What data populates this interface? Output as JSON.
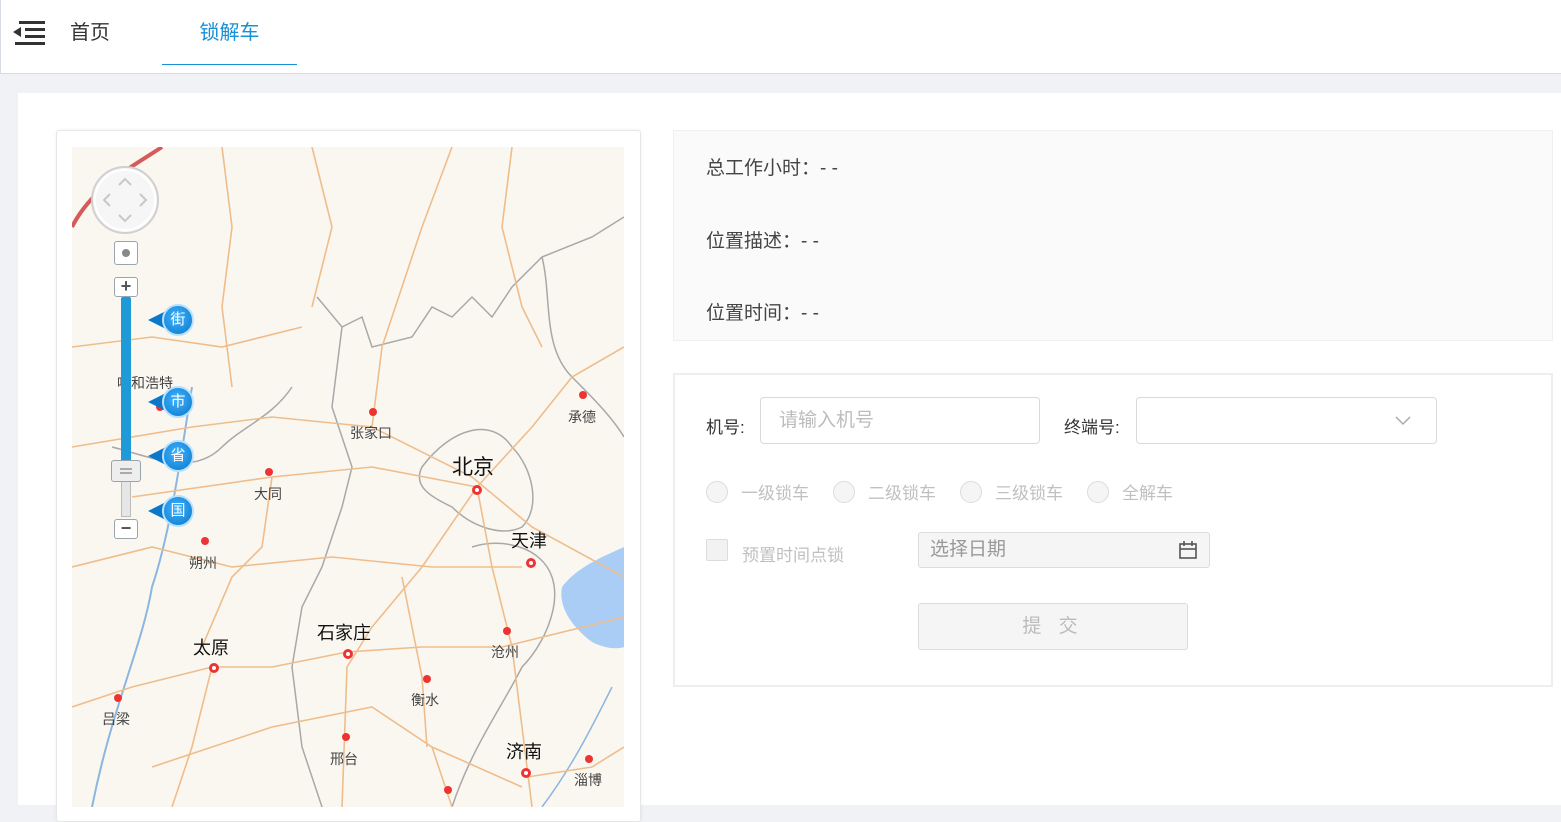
{
  "nav": {
    "home": "首页",
    "active_tab": "锁解车"
  },
  "map": {
    "level_buttons": [
      "街",
      "市",
      "省",
      "国"
    ],
    "cities": {
      "hohhot": "呼和浩特",
      "zhangjiakou": "张家口",
      "chengde": "承德",
      "beijing": "北京",
      "datong": "大同",
      "tianjin": "天津",
      "shuozhou": "朔州",
      "taiyuan": "太原",
      "shijiazhuang": "石家庄",
      "cangzhou": "沧州",
      "hengshui": "衡水",
      "lvliang": "吕梁",
      "xingtai": "邢台",
      "jinan": "济南",
      "zibo": "淄博"
    }
  },
  "info": {
    "total_hours": "总工作小时：- -",
    "location_desc": "位置描述：- -",
    "location_time": "位置时间：- -"
  },
  "form": {
    "machine_label": "机号:",
    "machine_placeholder": "请输入机号",
    "terminal_label": "终端号:",
    "lock_options": [
      "一级锁车",
      "二级锁车",
      "三级锁车",
      "全解车"
    ],
    "preset_label": "预置时间点锁",
    "date_placeholder": "选择日期",
    "submit": "提 交"
  }
}
